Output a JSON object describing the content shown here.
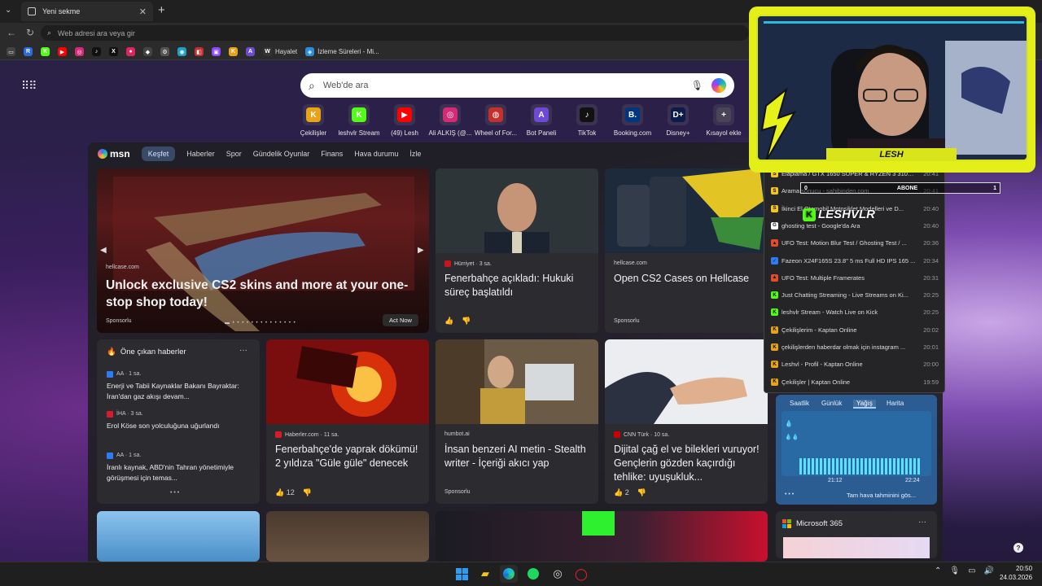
{
  "browser": {
    "tab_title": "Yeni sekme",
    "address_placeholder": "Web adresi ara veya gir",
    "bookmarks": [
      {
        "label": "",
        "icon": "R",
        "color": "#2a6be0"
      },
      {
        "label": "",
        "icon": "K",
        "color": "#53fc18"
      },
      {
        "label": "",
        "icon": "▶",
        "color": "#ff0000"
      },
      {
        "label": "",
        "icon": "◎",
        "color": "#d62976"
      },
      {
        "label": "",
        "icon": "♪",
        "color": "#111111"
      },
      {
        "label": "",
        "icon": "X",
        "color": "#111111"
      },
      {
        "label": "",
        "icon": "●",
        "color": "#e0245e"
      },
      {
        "label": "",
        "icon": "◆",
        "color": "#444444"
      },
      {
        "label": "",
        "icon": "⚙",
        "color": "#555555"
      },
      {
        "label": "",
        "icon": "◉",
        "color": "#1ea1c8"
      },
      {
        "label": "",
        "icon": "◧",
        "color": "#c4302b"
      },
      {
        "label": "",
        "icon": "▣",
        "color": "#9146ff"
      },
      {
        "label": "",
        "icon": "K",
        "color": "#e8a317"
      },
      {
        "label": "",
        "icon": "A",
        "color": "#6e49d6"
      },
      {
        "label": "Hayalet",
        "icon": "W",
        "color": "#333333"
      },
      {
        "label": "İzleme Süreleri - Mi...",
        "icon": "◈",
        "color": "#2a8ee0"
      }
    ]
  },
  "newtab": {
    "search_placeholder": "Web'de ara",
    "shortcuts": [
      {
        "label": "Çekilişler",
        "icon": "K",
        "color": "#e8a317"
      },
      {
        "label": "leshvlr Stream",
        "icon": "K",
        "color": "#53fc18"
      },
      {
        "label": "(49) Lesh",
        "icon": "▶",
        "color": "#ff0000"
      },
      {
        "label": "Ali ALKIŞ (@...",
        "icon": "◎",
        "color": "#d62976"
      },
      {
        "label": "Wheel of For...",
        "icon": "◍",
        "color": "#c4302b"
      },
      {
        "label": "Bot Paneli",
        "icon": "A",
        "color": "#6e49d6"
      },
      {
        "label": "TikTok",
        "icon": "♪",
        "color": "#111111"
      },
      {
        "label": "Booking.com",
        "icon": "B.",
        "color": "#003580"
      },
      {
        "label": "Disney+",
        "icon": "D+",
        "color": "#0b1b4a"
      },
      {
        "label": "Kısayol ekle",
        "icon": "+",
        "color": "#4a4458"
      }
    ]
  },
  "msn": {
    "logo": "msn",
    "nav": [
      "Keşfet",
      "Haberler",
      "Spor",
      "Gündelik Oyunlar",
      "Finans",
      "Hava durumu",
      "İzle"
    ],
    "hero": {
      "source": "hellcase.com",
      "title": "Unlock exclusive CS2 skins and more at your one-stop shop today!",
      "sponsor": "Sponsorlu",
      "cta": "Act Now"
    },
    "card_fb": {
      "source": "Hürriyet · 3 sa.",
      "title": "Fenerbahçe açıkladı: Hukuki süreç başlatıldı"
    },
    "card_cs2": {
      "source": "hellcase.com",
      "title": "Open CS2 Cases on Hellcase",
      "sponsor": "Sponsorlu"
    },
    "top_news": {
      "header": "Öne çıkan haberler",
      "items": [
        {
          "source": "AA · 1 sa.",
          "title": "Enerji ve Tabii Kaynaklar Bakanı Bayraktar: İran'dan gaz akışı devam..."
        },
        {
          "source": "İHA · 3 sa.",
          "title": "Erol Köse son yolculuğuna uğurlandı"
        },
        {
          "source": "AA · 1 sa.",
          "title": "İranlı kaynak, ABD'nin Tahran yönetimiyle görüşmesi için temas..."
        }
      ]
    },
    "card_fb2": {
      "source": "Haberler.com · 11 sa.",
      "title": "Fenerbahçe'de yaprak dökümü! 2 yıldıza \"Güle güle\" denecek",
      "likes": "12"
    },
    "card_ai": {
      "source": "humbot.ai",
      "title": "İnsan benzeri AI metin - Stealth writer - İçeriği akıcı yap",
      "sponsor": "Sponsorlu"
    },
    "card_cnn": {
      "source": "CNN Türk · 10 sa.",
      "title": "Dijital çağ el ve bilekleri vuruyor! Gençlerin gözden kaçırdığı tehlike: uyuşukluk...",
      "likes": "2"
    },
    "weather": {
      "tabs": [
        "Saatlik",
        "Günlük",
        "Yağış",
        "Harita"
      ],
      "active_tab": "Yağış",
      "times": [
        "21:12",
        "22:24"
      ],
      "footer": "Tam hava tahminini gös..."
    },
    "m365": "Microsoft 365"
  },
  "history": [
    {
      "title": "Elaplama / GTX 1650 SUPER & RYZEN 3 3100 s...",
      "time": "20:41",
      "icon": "S",
      "color": "#f5c518"
    },
    {
      "title": "Arama sonucu - sahibinden.com",
      "time": "20:41",
      "icon": "S",
      "color": "#f5c518"
    },
    {
      "title": "İkinci El Otomobil Motosiklet Modelleri ve D...",
      "time": "20:40",
      "icon": "S",
      "color": "#f5c518"
    },
    {
      "title": "ghosting test - Google'da Ara",
      "time": "20:40",
      "icon": "G",
      "color": "#ffffff"
    },
    {
      "title": "UFO Test: Motion Blur Test / Ghosting Test / ...",
      "time": "20:36",
      "icon": "▲",
      "color": "#e34c26"
    },
    {
      "title": "Fazeon X24F165S 23.8\" 5 ms Full HD IPS 165 ...",
      "time": "20:34",
      "icon": "✓",
      "color": "#2f7bf5"
    },
    {
      "title": "UFO Test: Multiple Framerates",
      "time": "20:31",
      "icon": "▲",
      "color": "#e34c26"
    },
    {
      "title": "Just Chatting Streaming - Live Streams on Ki...",
      "time": "20:25",
      "icon": "K",
      "color": "#53fc18"
    },
    {
      "title": "leshvlr Stream - Watch Live on Kick",
      "time": "20:25",
      "icon": "K",
      "color": "#53fc18"
    },
    {
      "title": "Çekilişlerim - Kaptan Online",
      "time": "20:02",
      "icon": "K",
      "color": "#e8a317"
    },
    {
      "title": "çekilişlerden haberdar olmak için instagram ...",
      "time": "20:01",
      "icon": "K",
      "color": "#e8a317"
    },
    {
      "title": "Leshvl - Profil - Kaptan Online",
      "time": "20:00",
      "icon": "K",
      "color": "#e8a317"
    },
    {
      "title": "Çekilişler | Kaptan Online",
      "time": "19:59",
      "icon": "K",
      "color": "#e8a317"
    }
  ],
  "overlay": {
    "name": "LESH",
    "abone_left": "0",
    "abone_label": "ABONE",
    "abone_right": "1",
    "kick_name": "LESHVLR"
  },
  "taskbar": {
    "time": "20:50",
    "date": "24.03.2026"
  }
}
